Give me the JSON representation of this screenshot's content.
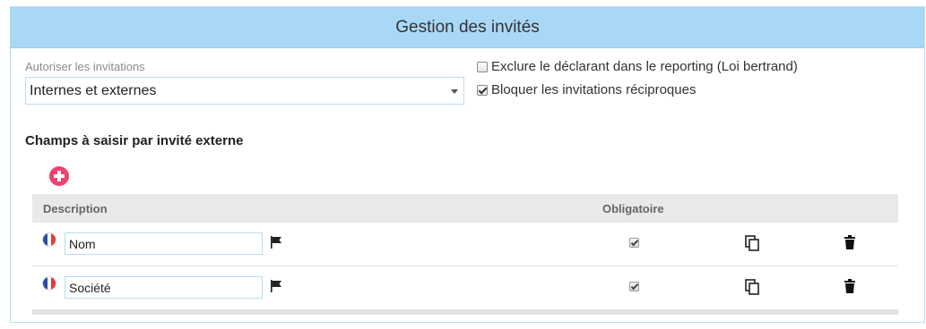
{
  "panel": {
    "title": "Gestion des invités"
  },
  "invitations": {
    "label": "Autoriser les invitations",
    "selected": "Internes et externes"
  },
  "options": [
    {
      "label": "Exclure le déclarant dans le reporting (Loi bertrand)",
      "checked": false
    },
    {
      "label": "Bloquer les invitations réciproques",
      "checked": true
    }
  ],
  "fields_section": {
    "title": "Champs à saisir par invité externe",
    "columns": {
      "description": "Description",
      "required": "Obligatoire"
    },
    "rows": [
      {
        "value": "Nom",
        "required": true
      },
      {
        "value": "Société",
        "required": true
      }
    ]
  },
  "colors": {
    "header_bg": "#a9d8f7",
    "border": "#b9dcef",
    "add_button": "#f0406e"
  },
  "icons": [
    "add-icon",
    "france-flag-icon",
    "language-flag-icon",
    "copy-icon",
    "trash-icon",
    "caret-down-icon"
  ]
}
